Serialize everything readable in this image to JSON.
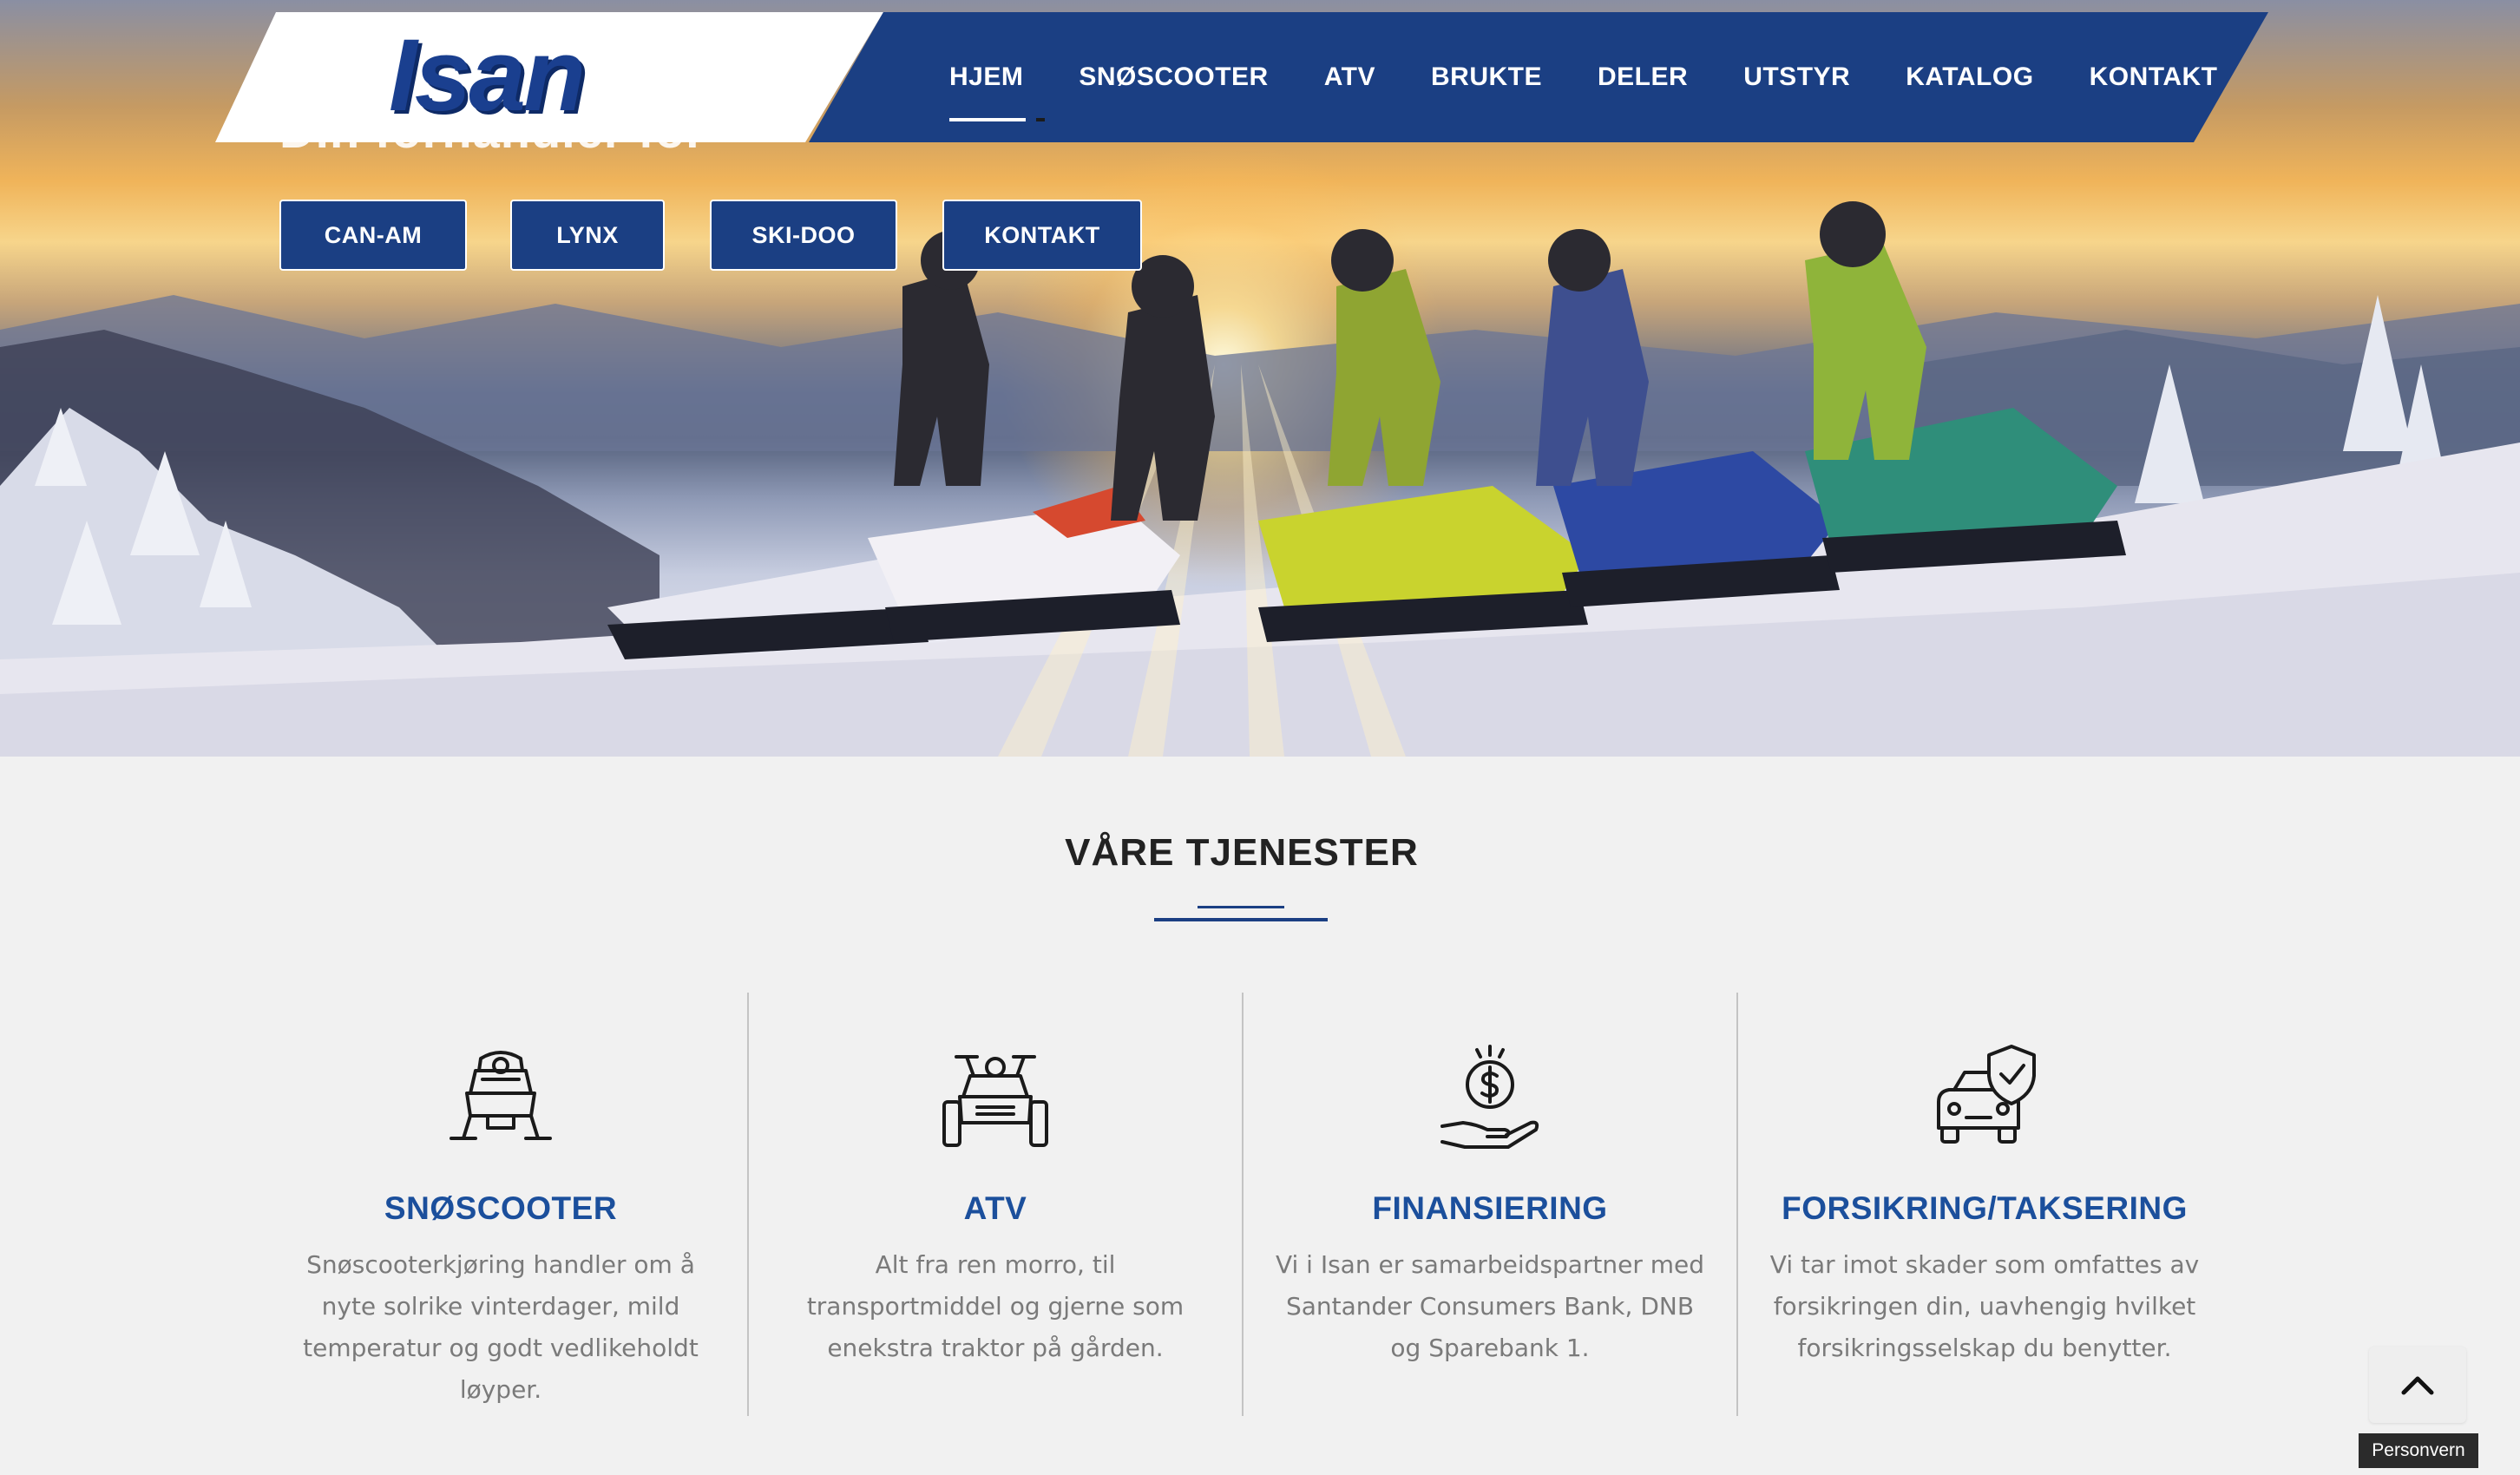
{
  "hero": {
    "subtitle": "Din forhandler for",
    "buttons": [
      {
        "label": "CAN-AM"
      },
      {
        "label": "LYNX"
      },
      {
        "label": "SKI-DOO"
      },
      {
        "label": "KONTAKT"
      }
    ]
  },
  "brand": {
    "logo_text": "Isan"
  },
  "nav": {
    "items": [
      {
        "label": "HJEM",
        "active": true
      },
      {
        "label": "SNØSCOOTER"
      },
      {
        "label": "ATV"
      },
      {
        "label": "BRUKTE"
      },
      {
        "label": "DELER"
      },
      {
        "label": "UTSTYR"
      },
      {
        "label": "KATALOG"
      },
      {
        "label": "KONTAKT"
      }
    ]
  },
  "services": {
    "title": "VÅRE TJENESTER",
    "items": [
      {
        "icon": "snowmobile-icon",
        "title": "SNØSCOOTER",
        "text": "Snøscooterkjøring handler om å nyte solrike vinterdager, mild temperatur og godt vedlikeholdt løyper."
      },
      {
        "icon": "atv-icon",
        "title": "ATV",
        "text": "Alt fra ren morro, til transportmiddel og gjerne som enekstra traktor på gården."
      },
      {
        "icon": "money-hand-icon",
        "title": "FINANSIERING",
        "text": "Vi i Isan er samarbeidspartner med Santander Consumers Bank, DNB og Sparebank 1."
      },
      {
        "icon": "car-shield-icon",
        "title": "FORSIKRING/TAKSERING",
        "text": "Vi tar imot skader som omfattes av forsikringen din, uavhengig hvilket forsikringsselskap du benytter."
      }
    ]
  },
  "footer": {
    "privacy_label": "Personvern",
    "to_top_icon": "chevron-up-icon"
  },
  "colors": {
    "brand_blue": "#1b3f83",
    "service_title": "#1b4f9c",
    "text_gray": "#7a7a7a"
  }
}
